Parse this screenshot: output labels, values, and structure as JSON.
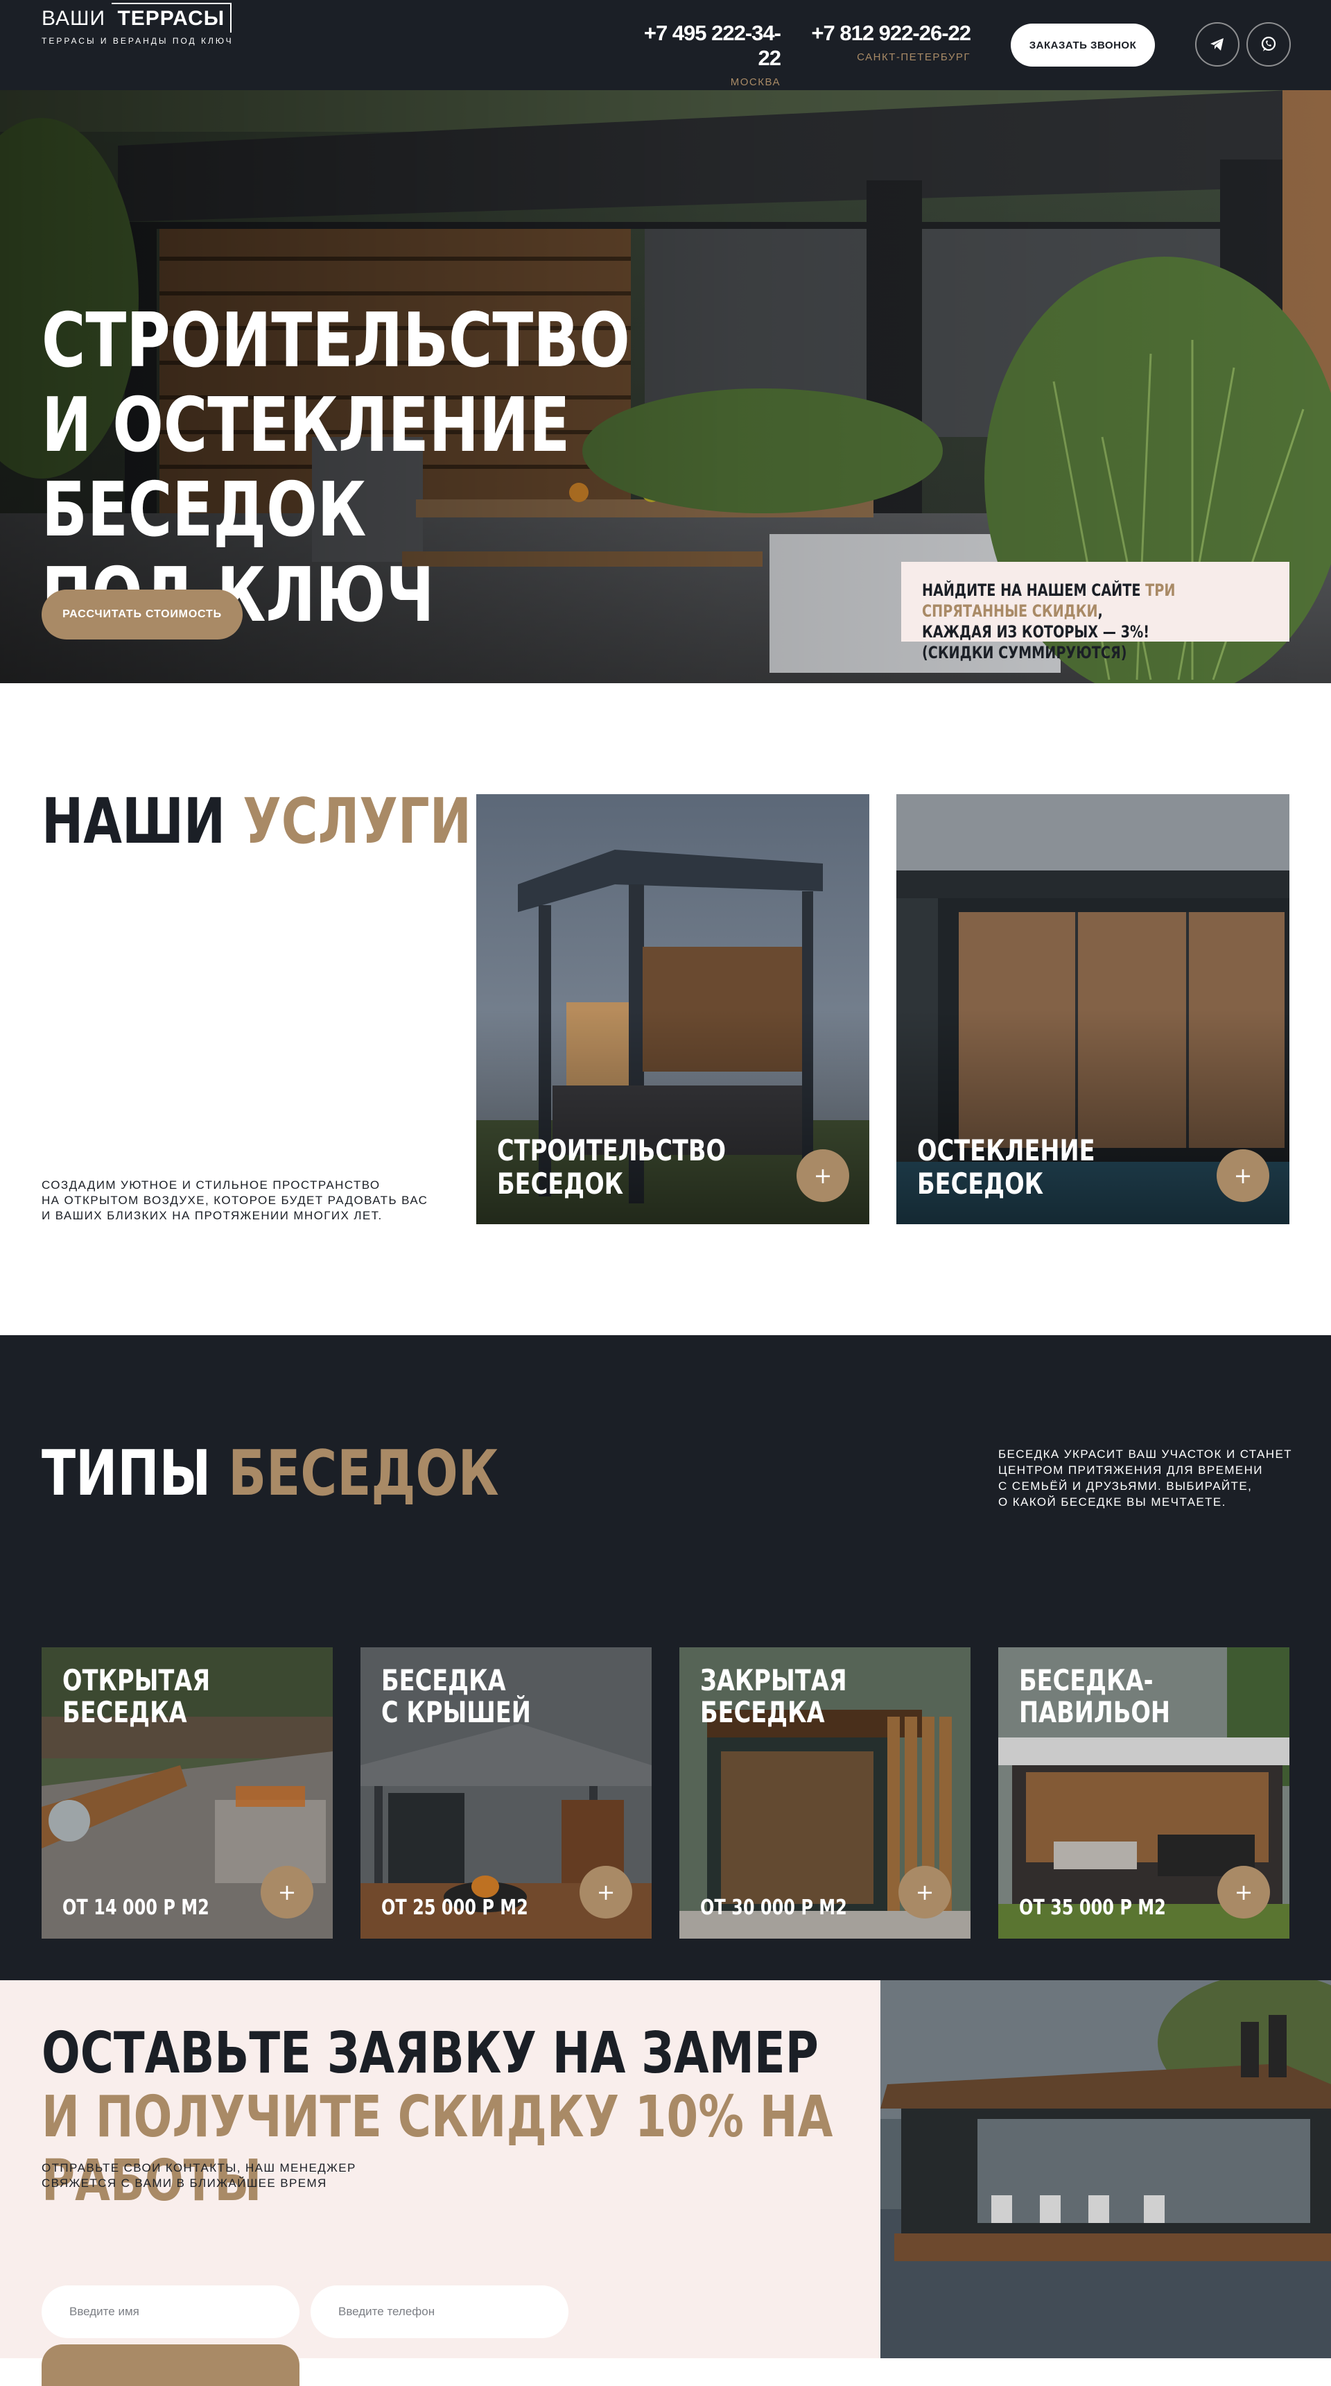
{
  "header": {
    "logo_light": "ВАШИ",
    "logo_bold": "ТЕРРАСЫ",
    "logo_tagline": "ТЕРРАСЫ И ВЕРАНДЫ ПОД КЛЮЧ",
    "phones": [
      {
        "number": "+7 495 222-34-22",
        "city": "МОСКВА"
      },
      {
        "number": "+7 812 922-26-22",
        "city": "САНКТ-ПЕТЕРБУРГ"
      }
    ],
    "call_button": "ЗАКАЗАТЬ ЗВОНОК",
    "social_icons": [
      "telegram-icon",
      "whatsapp-icon"
    ]
  },
  "hero": {
    "title_lines": [
      "СТРОИТЕЛЬСТВО",
      "И ОСТЕКЛЕНИЕ БЕСЕДОК",
      "ПОД КЛЮЧ"
    ],
    "button": "РАССЧИТАТЬ СТОИМОСТЬ",
    "promo_prefix": "НАЙДИТЕ НА НАШЕМ САЙТЕ ",
    "promo_accent": "ТРИ СПРЯТАННЫЕ СКИДКИ",
    "promo_suffix": ",",
    "promo_line2": "КАЖДАЯ ИЗ КОТОРЫХ — 3%! (СКИДКИ СУММИРУЮТСЯ)"
  },
  "services": {
    "title_dark": "НАШИ ",
    "title_accent": "УСЛУГИ",
    "description_lines": [
      "СОЗДАДИМ УЮТНОЕ И СТИЛЬНОЕ ПРОСТРАНСТВО",
      "НА ОТКРЫТОМ ВОЗДУХЕ, КОТОРОЕ БУДЕТ РАДОВАТЬ ВАС",
      "И ВАШИХ БЛИЗКИХ НА ПРОТЯЖЕНИИ МНОГИХ ЛЕТ."
    ],
    "cards": [
      {
        "line1": "СТРОИТЕЛЬСТВО",
        "line2": "БЕСЕДОК",
        "button": "+"
      },
      {
        "line1": "ОСТЕКЛЕНИЕ",
        "line2": "БЕСЕДОК",
        "button": "+"
      }
    ]
  },
  "types": {
    "title_light": "ТИПЫ ",
    "title_accent": "БЕСЕДОК",
    "description_lines": [
      "БЕСЕДКА УКРАСИТ ВАШ УЧАСТОК И СТАНЕТ",
      "ЦЕНТРОМ ПРИТЯЖЕНИЯ ДЛЯ ВРЕМЕНИ",
      "С СЕМЬЁЙ И ДРУЗЬЯМИ. ВЫБИРАЙТЕ,",
      "О КАКОЙ БЕСЕДКЕ ВЫ МЕЧТАЕТЕ."
    ],
    "cards": [
      {
        "line1": "ОТКРЫТАЯ",
        "line2": "БЕСЕДКА",
        "price": "ОТ 14 000 Р М2",
        "button": "+"
      },
      {
        "line1": "БЕСЕДКА",
        "line2": "С КРЫШЕЙ",
        "price": "ОТ 25 000 Р М2",
        "button": "+"
      },
      {
        "line1": "ЗАКРЫТАЯ",
        "line2": "БЕСЕДКА",
        "price": "ОТ 30 000 Р М2",
        "button": "+"
      },
      {
        "line1": "БЕСЕДКА-",
        "line2": "ПАВИЛЬОН",
        "price": "ОТ 35 000 Р М2",
        "button": "+"
      }
    ]
  },
  "request": {
    "title_line1": "ОСТАВЬТЕ ЗАЯВКУ НА ЗАМЕР",
    "title_line2": "И ПОЛУЧИТЕ СКИДКУ 10% НА РАБОТЫ",
    "description_lines": [
      "ОТПРАВЬТЕ СВОИ КОНТАКТЫ, НАШ МЕНЕДЖЕР",
      "СВЯЖЕТСЯ С ВАМИ В БЛИЖАЙШЕЕ ВРЕМЯ"
    ],
    "name_placeholder": "Введите имя",
    "phone_placeholder": "Введите телефон"
  },
  "colors": {
    "dark": "#1b1f26",
    "accent": "#a98a66",
    "promo_bg": "#f7ecea",
    "request_bg": "#f9eeec"
  }
}
